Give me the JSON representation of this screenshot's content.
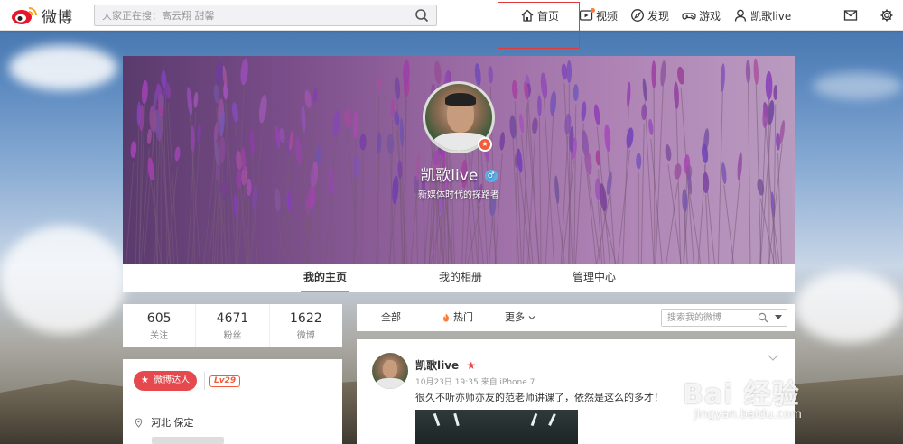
{
  "topbar": {
    "logo_text": "微博",
    "search_placeholder": "大家正在搜：高云翔 甜馨",
    "nav": [
      {
        "label": "首页",
        "icon": "home-icon"
      },
      {
        "label": "视频",
        "icon": "video-icon"
      },
      {
        "label": "发现",
        "icon": "compass-icon"
      },
      {
        "label": "游戏",
        "icon": "gamepad-icon"
      },
      {
        "label": "凯歌live",
        "icon": "user-icon"
      }
    ]
  },
  "profile": {
    "name": "凯歌live",
    "gender_symbol": "♂",
    "bio": "新媒体时代的探路者",
    "tabs": [
      "我的主页",
      "我的相册",
      "管理中心"
    ],
    "stats": [
      {
        "num": "605",
        "label": "关注"
      },
      {
        "num": "4671",
        "label": "粉丝"
      },
      {
        "num": "1622",
        "label": "微博"
      }
    ],
    "talent_label": "微博达人",
    "level": "Lv29",
    "location": "河北 保定"
  },
  "feed": {
    "filter_all": "全部",
    "filter_hot": "热门",
    "filter_more": "更多",
    "search_placeholder": "搜索我的微博"
  },
  "post": {
    "author": "凯歌live",
    "meta": "10月23日 19:35 来自 iPhone 7",
    "text": "很久不听亦师亦友的范老师讲课了，依然是这么的多才！"
  },
  "watermark": {
    "main": "Bai 经验",
    "sub": "jingyan.baidu.com"
  },
  "colors": {
    "accent": "#fa7d3c",
    "red": "#e5484d",
    "highlight": "#e23b3b"
  }
}
